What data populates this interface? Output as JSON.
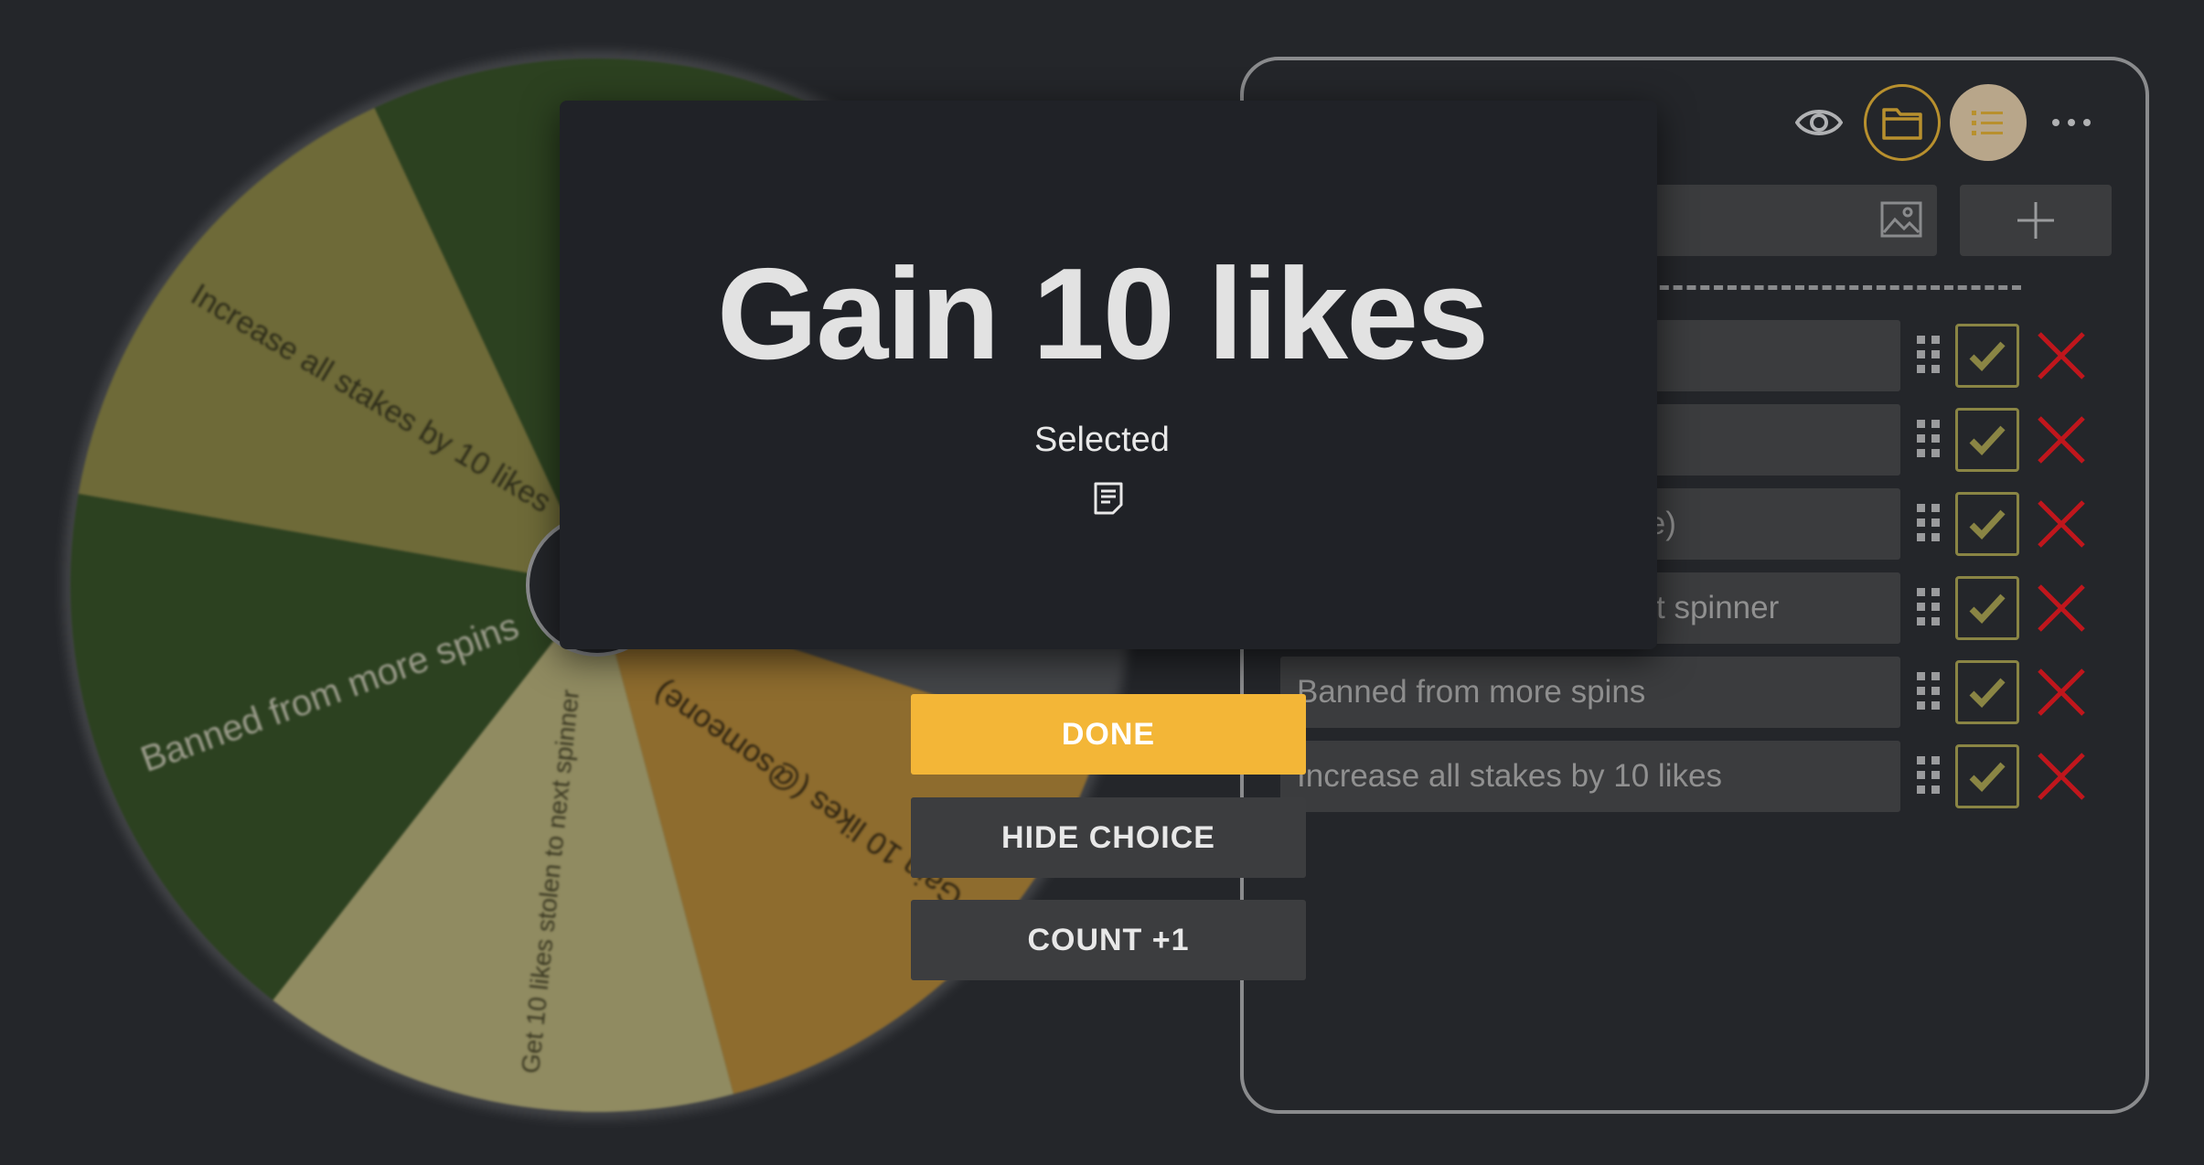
{
  "wheel": {
    "segments": [
      {
        "label": "Increase all stakes by 10 likes",
        "color": "#6e6a38"
      },
      {
        "label": "Banned from more spins",
        "color": "#2c4120"
      },
      {
        "label": "Get 10 likes stolen to next spinner",
        "color": "#908b61"
      },
      {
        "label": "Gain 10 likes (@someone)",
        "color": "#8e6c2e"
      },
      {
        "label": "Gain 10 likes",
        "color": "#2c4120"
      }
    ]
  },
  "modal": {
    "title": "Gain 10 likes",
    "subtitle": "Selected",
    "note_icon": "note-icon"
  },
  "actions": {
    "done_label": "DONE",
    "hide_label": "HIDE CHOICE",
    "count_label": "COUNT +1"
  },
  "panel": {
    "toolbar": {
      "eye_icon": "eye-icon",
      "folder_icon": "folder-icon",
      "list_icon": "list-icon",
      "more_icon": "more-icon"
    },
    "entries": [
      {
        "text": ""
      },
      {
        "text": ""
      },
      {
        "text": "Gain 10 likes (@someone)"
      },
      {
        "text": "Get 10 likes stolen to next spinner"
      },
      {
        "text": "Banned from more spins"
      },
      {
        "text": "Increase all stakes by 10 likes"
      }
    ]
  },
  "colors": {
    "background": "#24262a",
    "accent": "#f3b637",
    "check": "#8a8544",
    "delete": "#c0161c"
  }
}
